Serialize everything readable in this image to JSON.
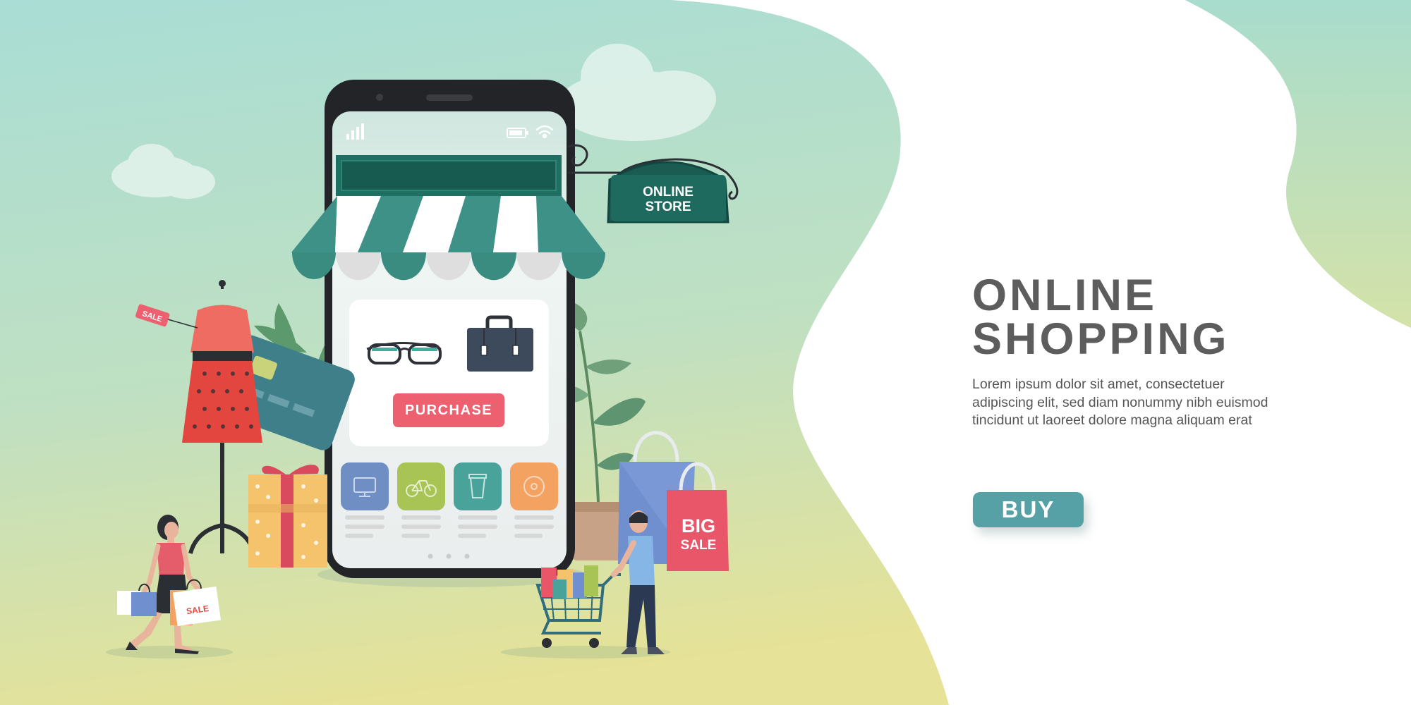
{
  "brand_colors": {
    "bg_top": "#a9ddd5",
    "bg_bottom": "#e4e298",
    "teal": "#3e9186",
    "dark_teal": "#14584f",
    "pink": "#ec6070",
    "buy": "#56a1a6",
    "text": "#5d5d5d"
  },
  "hero": {
    "title_line1": "ONLINE",
    "title_line2": "SHOPPING",
    "body_lines": [
      "Lorem ipsum dolor sit amet, consectetuer",
      "adipiscing elit, sed diam nonummy nibh euismod",
      "tincidunt ut laoreet dolore magna aliquam erat"
    ],
    "buy_label": "BUY"
  },
  "phone": {
    "purchase_label": "PURCHASE",
    "product_icons": [
      "glasses-icon",
      "briefcase-icon"
    ],
    "category_icons": [
      "monitor-icon",
      "bicycle-icon",
      "cup-icon",
      "disc-icon"
    ],
    "category_colors": [
      "#6e8ec4",
      "#a8c455",
      "#4aa39a",
      "#f3a262"
    ],
    "status_icons": [
      "signal-icon",
      "battery-icon",
      "wifi-icon"
    ]
  },
  "sign": {
    "line1": "ONLINE",
    "line2": "STORE"
  },
  "tags": {
    "dress_tag": "SALE",
    "bag_label": "SALE",
    "big_sale_line1": "BIG",
    "big_sale_line2": "SALE"
  }
}
